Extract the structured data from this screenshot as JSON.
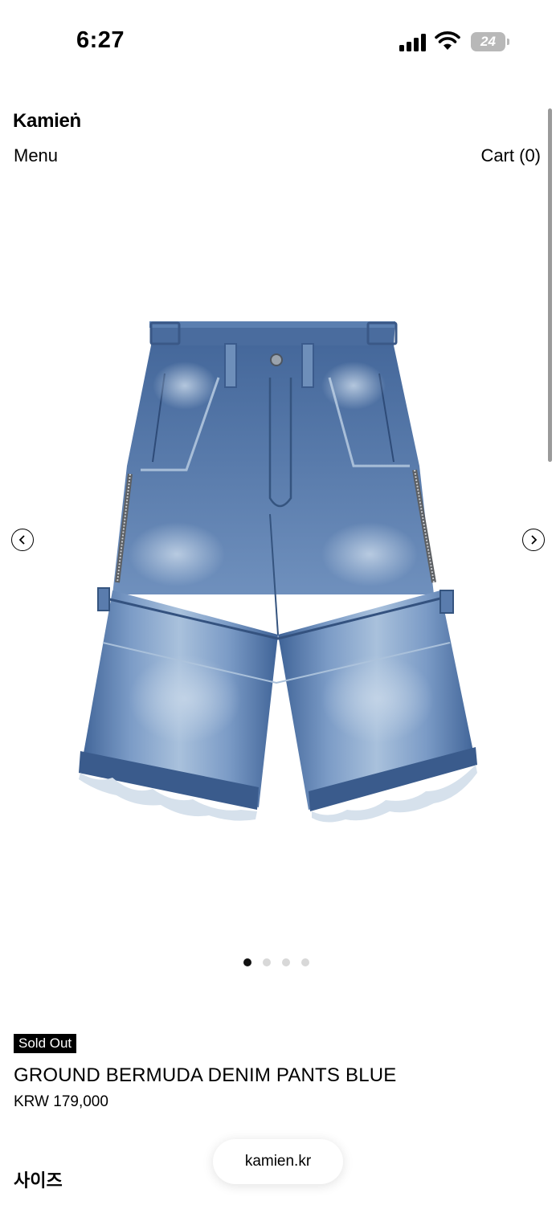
{
  "status_bar": {
    "time": "6:27",
    "battery_level": "24",
    "icons": [
      "cellular-signal-icon",
      "wifi-icon",
      "battery-icon"
    ]
  },
  "header": {
    "brand": "Kamieṅ",
    "menu_label": "Menu",
    "cart_label": "Cart (0)"
  },
  "gallery": {
    "image_name": "denim-shorts-photo",
    "prev_icon": "chevron-left-icon",
    "next_icon": "chevron-right-icon",
    "dots": 4,
    "active_dot": 1
  },
  "product": {
    "status_badge": "Sold Out",
    "title": "GROUND BERMUDA DENIM PANTS BLUE",
    "price": "KRW 179,000",
    "size_label": "사이즈"
  },
  "browser": {
    "url": "kamien.kr"
  },
  "colors": {
    "denim_mid": "#5a80b3",
    "denim_light": "#9fbad8",
    "denim_dark": "#3c5f92",
    "badge_bg": "#000000"
  }
}
